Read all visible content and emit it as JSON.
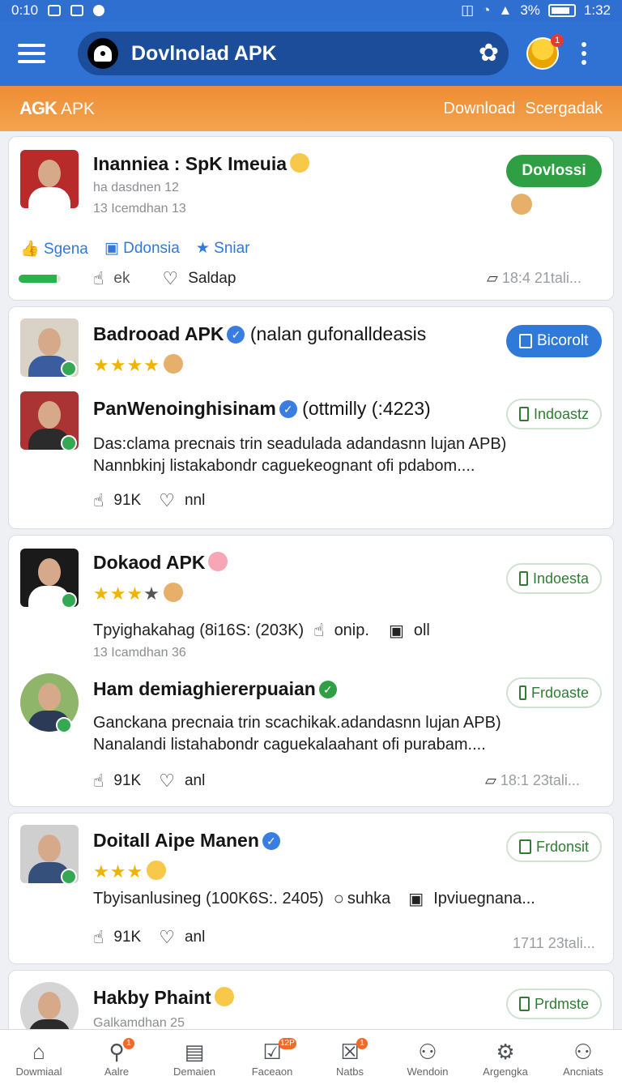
{
  "status_bar": {
    "time_left": "0:10",
    "battery": "3%",
    "time_right": "1:32"
  },
  "app_bar": {
    "title": "Dovlnolad APK"
  },
  "sub_bar": {
    "brand_a": "AGK",
    "brand_b": "APK",
    "links": [
      "Download",
      "Scergadak"
    ]
  },
  "cards": [
    {
      "title": "Inanniea : SpK Imeuia",
      "meta1": "ha dasdnen 12",
      "meta2": "13 Icemdhan 13",
      "button": "Dovlossi",
      "tags": [
        "Sgena",
        "Ddonsia",
        "Sniar"
      ],
      "progress": 0.9,
      "act1": "ek",
      "act2": "Saldap",
      "timestamp": "18:4 21tali..."
    },
    {
      "title": "Badrooad APK",
      "title_extra": "(nalan gufonalldeasis",
      "button": "Bicorolt",
      "sub_title": "PanWenoinghisinam",
      "sub_title_extra": "(ottmilly  (:4223)",
      "sub_button": "Indoastz",
      "desc1": "Das:clama precnais trin seadulada adandasnn lujan APB)",
      "desc2": "Nannbkinj listakabondr caguekeognant ofi pdabom....",
      "count": "91K",
      "act2": "nnl"
    },
    {
      "title": "Dokaod APK",
      "button": "Indoesta",
      "info": "Tpyighakahag (8i16S: (203K)",
      "info_act": "onip.",
      "info_act2": "oll",
      "meta": "13 Icamdhan 36",
      "sub_title": "Ham demiaghiererpuaian",
      "sub_button": "Frdoaste",
      "desc1": "Ganckana precnaia trin scachikak.adandasnn lujan APB)",
      "desc2": "Nanalandi listahabondr caguekalaahant ofi purabam....",
      "count": "91K",
      "act2": "anl",
      "timestamp": "18:1 23tali..."
    },
    {
      "title": "Doitall Aipe Manen",
      "button": "Frdonsit",
      "info": "Tbyisanlusineg (100K6S:. 2405)",
      "info_act": "suhka",
      "info_act2": "Ipviuegnana...",
      "count": "91K",
      "act2": "anl",
      "timestamp": "1711 23tali..."
    },
    {
      "title": "Hakby Phaint",
      "meta": "Galkamdhan 25",
      "button": "Prdmste"
    }
  ],
  "bottom_nav": [
    {
      "label": "Dowmiaal",
      "icon": "home-icon",
      "badge": ""
    },
    {
      "label": "Aalre",
      "icon": "search-icon",
      "badge": "1"
    },
    {
      "label": "Demaien",
      "icon": "news-icon",
      "badge": ""
    },
    {
      "label": "Faceaon",
      "icon": "check-box-icon",
      "badge": "12P"
    },
    {
      "label": "Natbs",
      "icon": "box-x-icon",
      "badge": "1"
    },
    {
      "label": "Wendoin",
      "icon": "person-icon",
      "badge": ""
    },
    {
      "label": "Argengka",
      "icon": "gear-icon",
      "badge": ""
    },
    {
      "label": "Ancniats",
      "icon": "person-icon",
      "badge": ""
    }
  ]
}
